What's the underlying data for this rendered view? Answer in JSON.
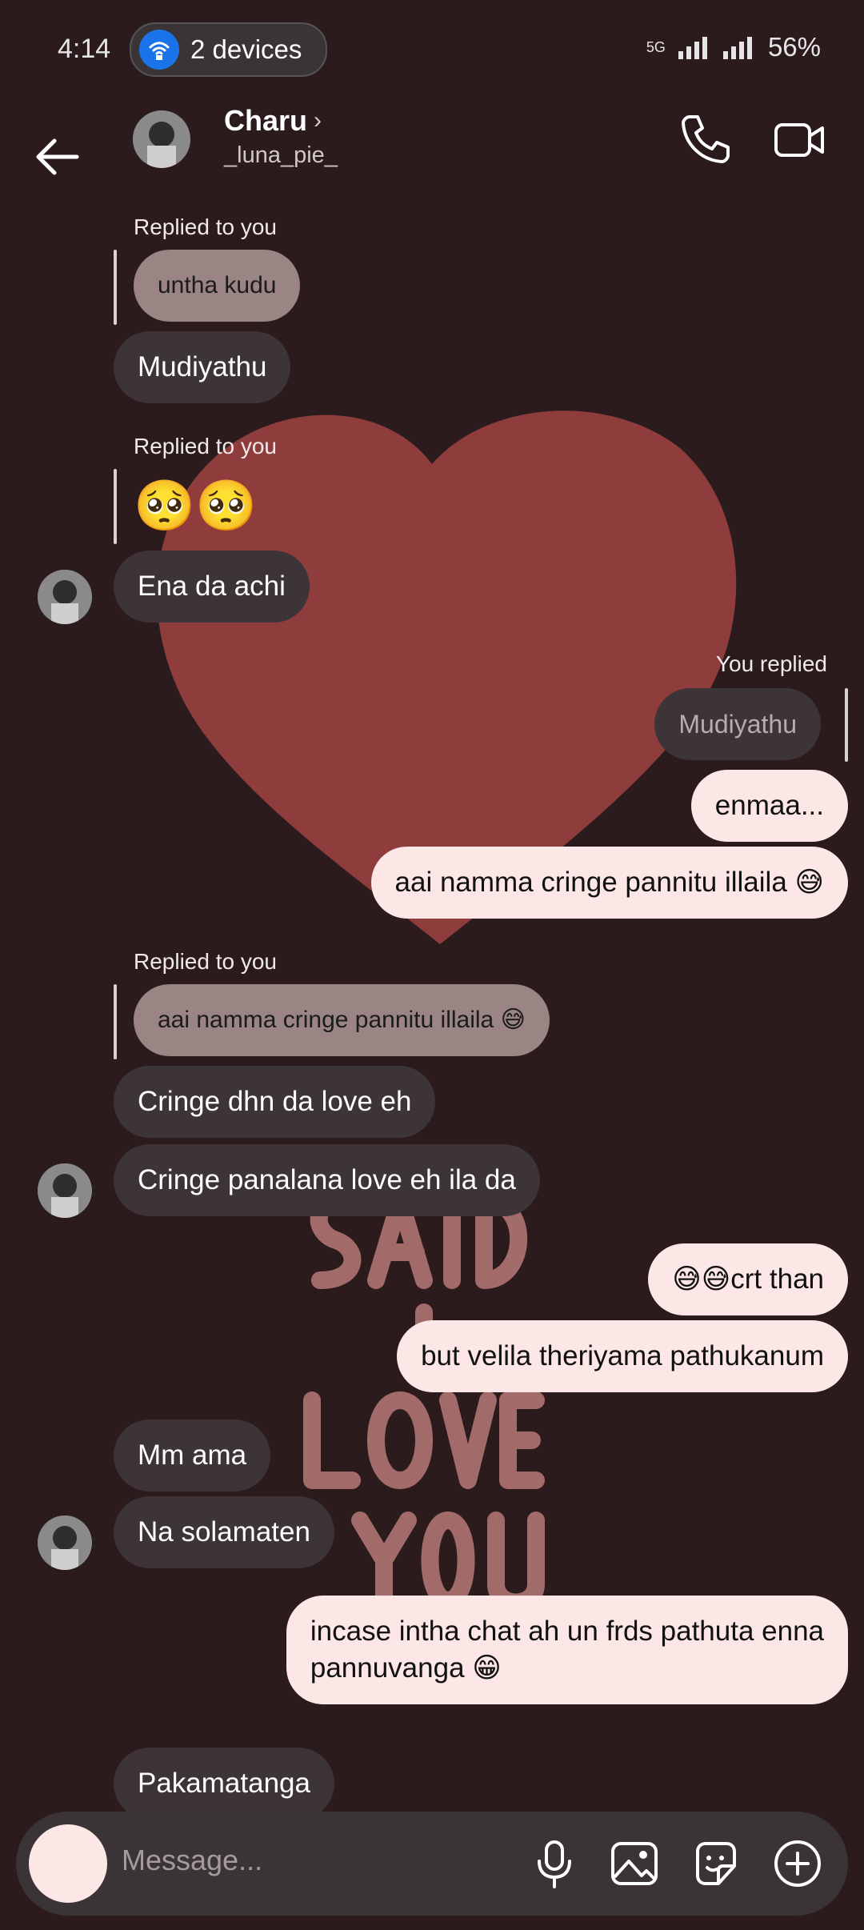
{
  "status_bar": {
    "time": "4:14",
    "devices": "2 devices",
    "network": "5G",
    "battery": "56%"
  },
  "header": {
    "name": "Charu",
    "username": "_luna_pie_"
  },
  "messages": {
    "m1_label": "Replied to you",
    "m1_quote": "untha kudu",
    "m2": "Mudiyathu",
    "m3_label": "Replied to you",
    "m3_emoji": "🥺🥺",
    "m4": "Ena da achi",
    "m5_label": "You replied",
    "m5_quote": "Mudiyathu",
    "m6": "enmaa...",
    "m7": "aai namma cringe pannitu illaila 😅",
    "m8_label": "Replied to you",
    "m8_quote": "aai namma cringe pannitu illaila 😅",
    "m9": "Cringe dhn da love eh",
    "m10": "Cringe panalana love eh ila da",
    "m11": "😅😅crt than",
    "m12": "but velila theriyama pathukanum",
    "m13": "Mm ama",
    "m14": "Na solamaten",
    "m15a": "incase intha chat ah un frds pathuta enna",
    "m15b": "pannuvanga 😁",
    "m16": "Pakamatanga"
  },
  "composer": {
    "placeholder": "Message..."
  },
  "colors": {
    "background": "#2b1b1d",
    "incoming": "#3c3436",
    "outgoing": "#fde6e6",
    "quoted": "#9a8484",
    "heart": "#8f3c3d"
  },
  "icons": [
    "back-arrow-icon",
    "chevron-right-icon",
    "phone-icon",
    "video-camera-icon",
    "microphone-icon",
    "image-icon",
    "sticker-icon",
    "plus-circle-icon"
  ]
}
